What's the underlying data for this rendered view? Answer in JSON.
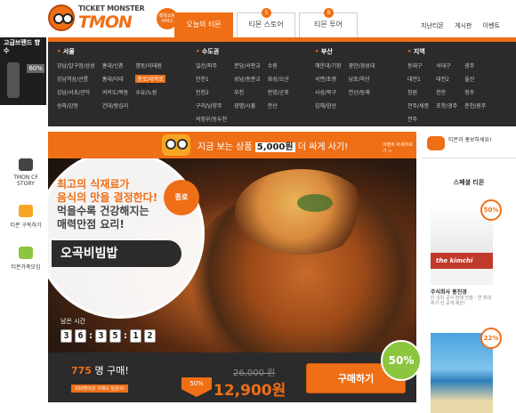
{
  "header": {
    "logo_small": "TICKET MONSTER",
    "logo_big": "TMON",
    "logo_badge": "행복쇼핑 서비스",
    "tabs": [
      {
        "label": "오늘의 티몬",
        "num": ""
      },
      {
        "label": "티몬 스토어",
        "num": "5"
      },
      {
        "label": "티몬 투어",
        "num": "8"
      }
    ],
    "links": [
      "지난티몬",
      "게시판",
      "이벤트"
    ]
  },
  "menu": {
    "sections": [
      {
        "title": "서울",
        "items": [
          "강남/압구정/삼성",
          "홍대/신촌",
          "명동/이태원",
          "강남역삼/선릉",
          "홍대/이대",
          "종로/대학로",
          "강남/서초/관악",
          "여의도/목동",
          "수유/노원",
          "송파/강동",
          "건대/왕십리"
        ],
        "highlight": 5
      },
      {
        "title": "수도권",
        "items": [
          "일산/파주",
          "분당/서판교",
          "수원",
          "인천1",
          "성남/동판교",
          "화성/오산",
          "인천2",
          "부천",
          "안양/군포",
          "구리/남양주",
          "광명/시흥",
          "안산",
          "의정부/동두천"
        ],
        "highlight": -1
      },
      {
        "title": "부산",
        "items": [
          "해운대/기장",
          "광안/경성대",
          "서면/초량",
          "남포/하단",
          "사상/북구",
          "연산/동래",
          "김해/양산"
        ],
        "highlight": -1
      },
      {
        "title": "지역",
        "items": [
          "동대구",
          "서대구",
          "광주",
          "대전1",
          "대전2",
          "울산",
          "창원",
          "천안",
          "청주",
          "전주/세종",
          "포항/경주",
          "춘천/원주",
          "전주"
        ],
        "highlight": -1
      }
    ]
  },
  "left_ad": {
    "title": "고급브랜드 향수",
    "pct": "60%"
  },
  "left_nav": [
    {
      "label": "TMON CF STORY"
    },
    {
      "label": "티몬 구독하기"
    },
    {
      "label": "티몬가족모임"
    }
  ],
  "promo": {
    "text_pre": "지금 보는 상품 ",
    "amount": "5,000원",
    "text_post": " 더 싸게 사기!",
    "sub": "이벤트 자세히보기 >"
  },
  "deal": {
    "badge": "종로",
    "headline1": "최고의 식재료가",
    "headline2": "음식의 맛을 결정한다!",
    "headline3": "먹을수록 건강해지는",
    "headline4": "매력만점 요리!",
    "name": "오곡비빔밥",
    "time_label": "남은 시간",
    "timer": [
      "3",
      "6",
      "3",
      "5",
      "1",
      "2"
    ],
    "bought_num": "775",
    "bought_suffix": "명 구매!",
    "bought_sub": "100명이상 구매시 딜성사!",
    "discount_arrow": "50%",
    "old_price": "26,000 원",
    "new_price": "12,900원",
    "buy_label": "구매하기",
    "discount": "50%"
  },
  "right": {
    "top": "티몬과 홍보하세요!",
    "title": "스페셜 티몬",
    "card1": {
      "pct": "50%",
      "brand": "the kimchi",
      "cap": "주식회사 홍진경",
      "cap2": "더 김치 공식 판매 진행 - 연 최대 특가 선 공개 제안!"
    },
    "card2": {
      "pct": "22%"
    }
  },
  "colors": {
    "accent": "#ef6f16",
    "dark": "#2b2b2b",
    "green": "#8cc63f"
  }
}
